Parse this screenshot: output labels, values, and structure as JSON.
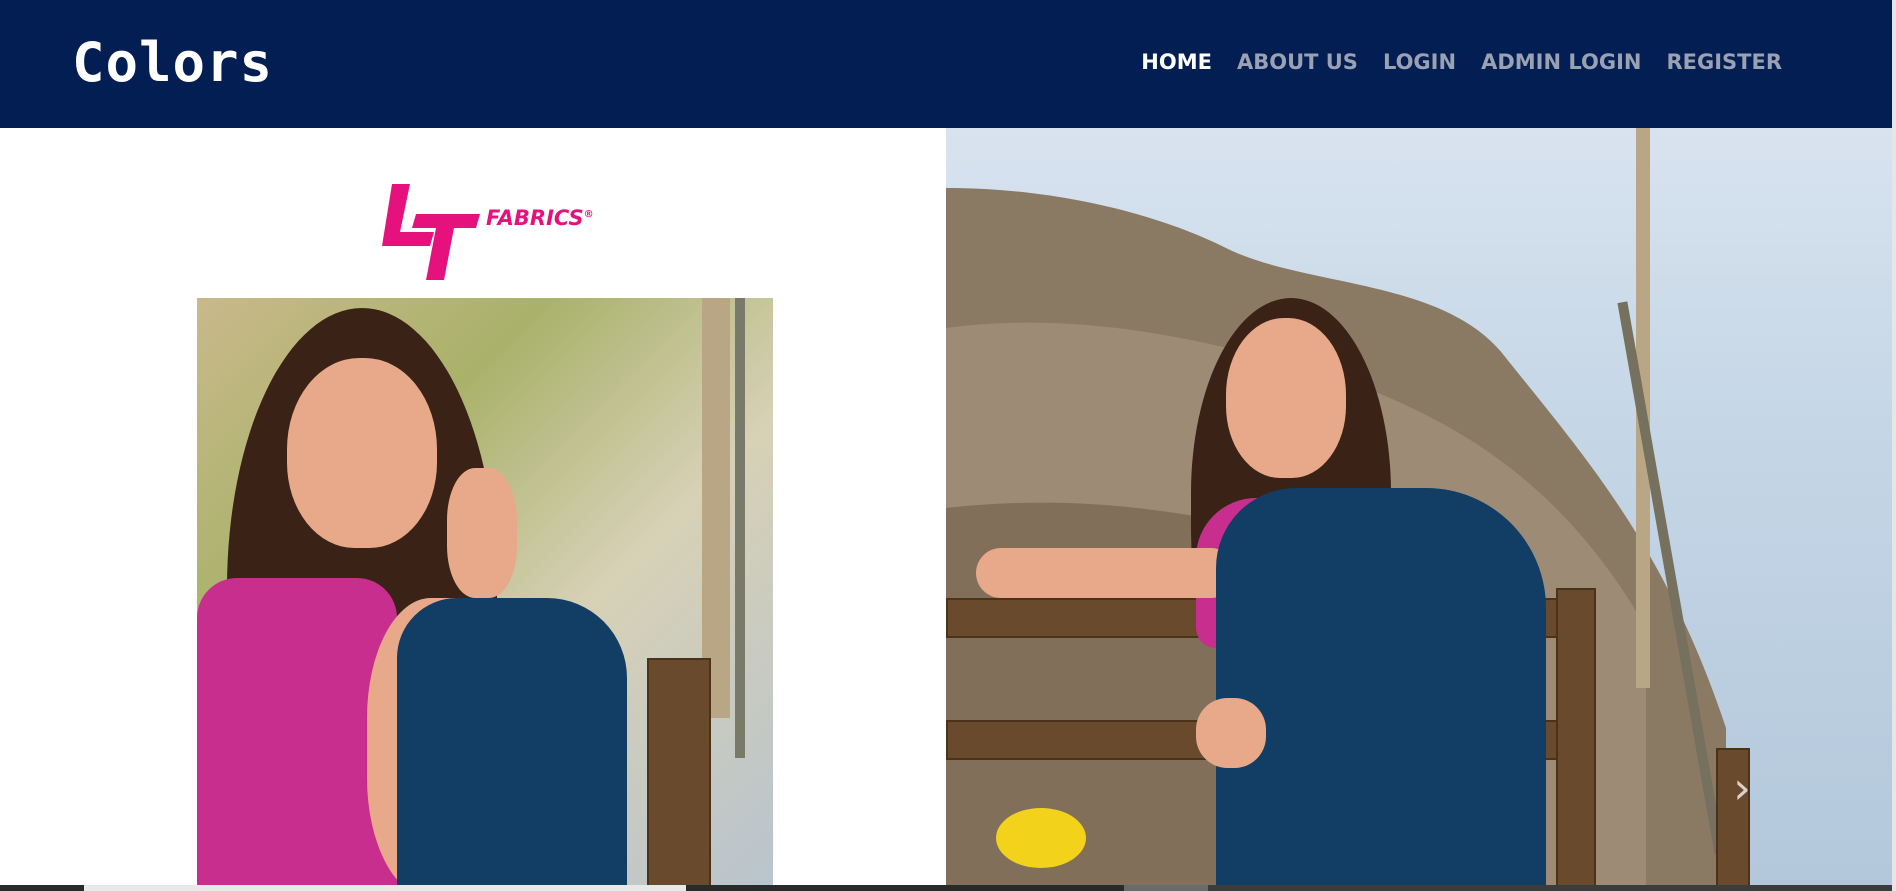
{
  "navbar": {
    "brand": "Colors",
    "links": [
      {
        "label": "HOME",
        "active": true
      },
      {
        "label": "ABOUT US",
        "active": false
      },
      {
        "label": "LOGIN",
        "active": false
      },
      {
        "label": "ADMIN LOGIN",
        "active": false
      },
      {
        "label": "REGISTER",
        "active": false
      }
    ]
  },
  "carousel": {
    "logo_text": "FABRICS",
    "logo_registered": "®",
    "next_icon": "chevron-right-icon",
    "indicator_count": 4,
    "active_indicator": 1
  },
  "colors": {
    "navbar_bg": "#021e52",
    "nav_active": "#ffffff",
    "nav_inactive": "#9aa1b2",
    "logo_pink": "#e5127d"
  }
}
